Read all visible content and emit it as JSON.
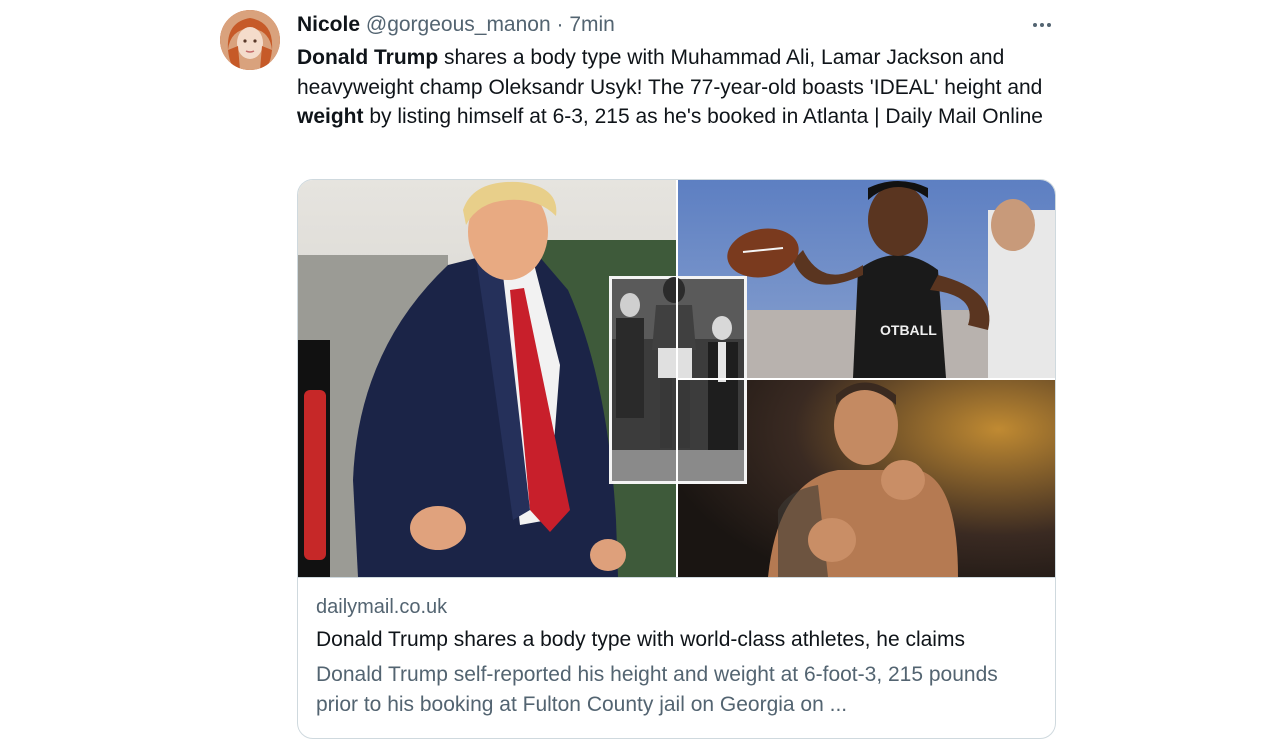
{
  "tweet": {
    "author_name": "Nicole",
    "handle": "@gorgeous_manon",
    "separator": "·",
    "time": "7min",
    "text_parts": [
      {
        "text": "Donald Trump",
        "bold": true
      },
      {
        "text": " shares a body type with Muhammad Ali, Lamar Jackson and heavyweight champ Oleksandr Usyk! The 77-year-old boasts 'IDEAL' height and ",
        "bold": false
      },
      {
        "text": "weight",
        "bold": true
      },
      {
        "text": " by listing himself at 6-3, 215 as he's booked in Atlanta | Daily Mail Online",
        "bold": false
      }
    ]
  },
  "card": {
    "domain": "dailymail.co.uk",
    "title": "Donald Trump shares a body type with world-class athletes, he claims",
    "description": "Donald Trump self-reported his height and weight at 6-foot-3, 215 pounds prior to his booking at Fulton County jail on Georgia on ...",
    "jersey_text": "OTBALL"
  },
  "icons": {
    "more": "more-horizontal-icon",
    "avatar": "avatar-portrait"
  },
  "colors": {
    "text_primary": "#0f1419",
    "text_secondary": "#536471",
    "border": "#cfd9de"
  }
}
